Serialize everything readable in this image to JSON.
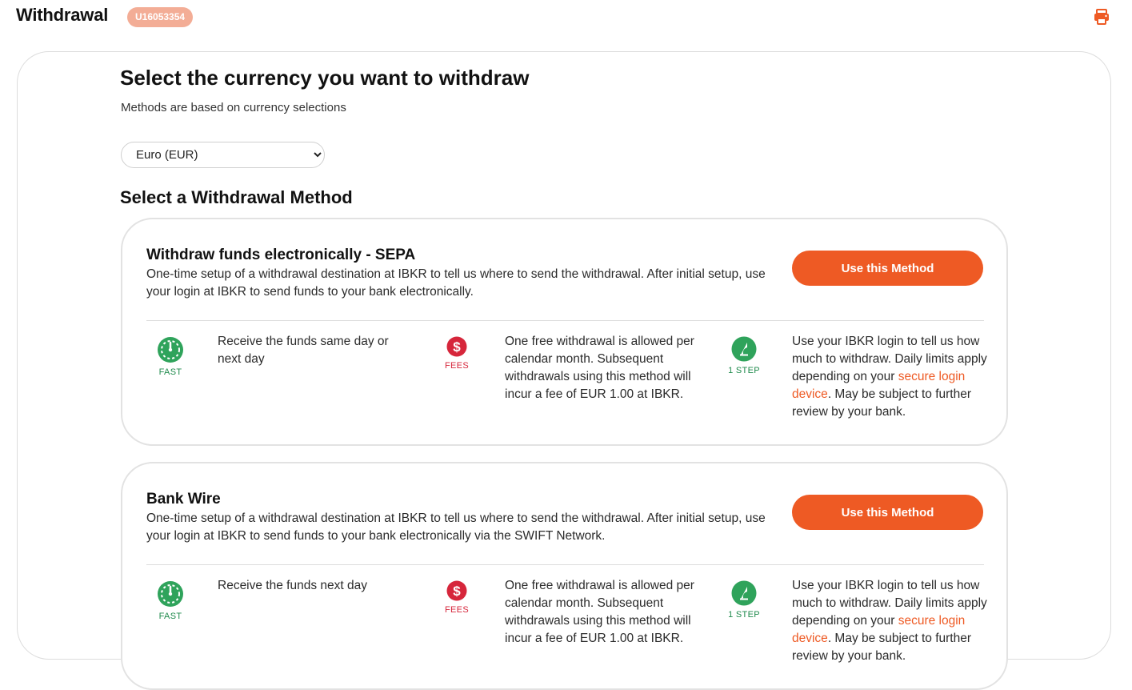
{
  "header": {
    "title": "Withdrawal",
    "account_id": "U16053354",
    "print_icon": "printer-icon"
  },
  "currency_section": {
    "heading": "Select the currency you want to withdraw",
    "subtext": "Methods are based on currency selections",
    "selected_currency": "Euro (EUR)"
  },
  "methods_heading": "Select a Withdrawal Method",
  "methods": [
    {
      "title": "Withdraw funds electronically - SEPA",
      "description": "One-time setup of a withdrawal destination at IBKR to tell us where to send the withdrawal. After initial setup, use your login at IBKR to send funds to your bank electronically.",
      "button_label": "Use this Method",
      "speed_caption": "FAST",
      "speed_text": "Receive the funds same day or next day",
      "fees_caption": "FEES",
      "fees_text": "One free withdrawal is allowed per calendar month. Subsequent withdrawals using this method will incur a fee of EUR 1.00 at IBKR.",
      "steps_caption": "1 STEP",
      "steps_text_before": "Use your IBKR login to tell us how much to withdraw. Daily limits apply depending on your ",
      "steps_link": "secure login device",
      "steps_text_after": ". May be subject to further review by your bank."
    },
    {
      "title": "Bank Wire",
      "description": "One-time setup of a withdrawal destination at IBKR to tell us where to send the withdrawal. After initial setup, use your login at IBKR to send funds to your bank electronically via the SWIFT Network.",
      "button_label": "Use this Method",
      "speed_caption": "FAST",
      "speed_text": "Receive the funds next day",
      "fees_caption": "FEES",
      "fees_text": "One free withdrawal is allowed per calendar month. Subsequent withdrawals using this method will incur a fee of EUR 1.00 at IBKR.",
      "steps_caption": "1 STEP",
      "steps_text_before": "Use your IBKR login to tell us how much to withdraw. Daily limits apply depending on your ",
      "steps_link": "secure login device",
      "steps_text_after": ". May be subject to further review by your bank."
    }
  ],
  "colors": {
    "accent": "#ee5a24",
    "badge": "#f3ad96",
    "fast_green": "#1f8a4c",
    "fees_red": "#d6263b"
  },
  "icons": {
    "speed": "speedometer-icon",
    "fees": "dollar-icon",
    "steps": "single-step-icon",
    "dropdown": "chevron-down-icon"
  }
}
